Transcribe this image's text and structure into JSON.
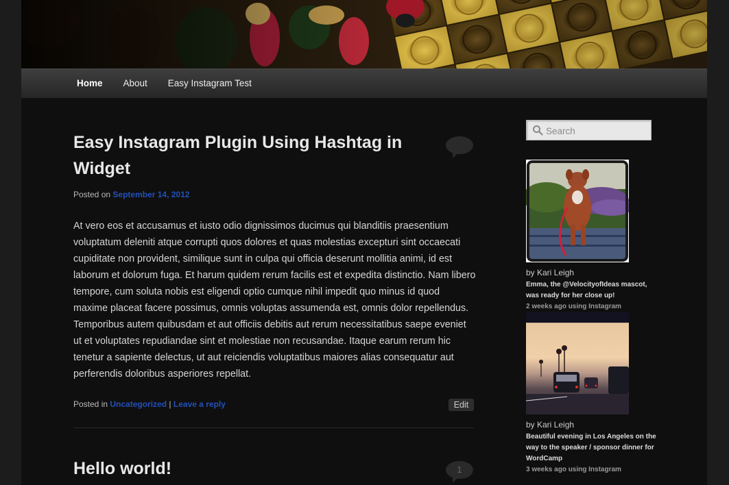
{
  "nav": {
    "items": [
      {
        "label": "Home"
      },
      {
        "label": "About"
      },
      {
        "label": "Easy Instagram Test"
      }
    ]
  },
  "posts": [
    {
      "title": "Easy Instagram Plugin Using Hashtag in Widget",
      "posted_on_label": "Posted on",
      "date": "September 14, 2012",
      "content": "At vero eos et accusamus et iusto odio dignissimos ducimus qui blanditiis praesentium voluptatum deleniti atque corrupti quos dolores et quas molestias excepturi sint occaecati cupiditate non provident, similique sunt in culpa qui officia deserunt mollitia animi, id est laborum et dolorum fuga. Et harum quidem rerum facilis est et expedita distinctio. Nam libero tempore, cum soluta nobis est eligendi optio cumque nihil impedit quo minus id quod maxime placeat facere possimus, omnis voluptas assumenda est, omnis dolor repellendus. Temporibus autem quibusdam et aut officiis debitis aut rerum necessitatibus saepe eveniet ut et voluptates repudiandae sint et molestiae non recusandae. Itaque earum rerum hic tenetur a sapiente delectus, ut aut reiciendis voluptatibus maiores alias consequatur aut perferendis doloribus asperiores repellat.",
      "posted_in_label": "Posted in",
      "category": "Uncategorized",
      "separator": "|",
      "reply_link": "Leave a reply",
      "edit_label": "Edit",
      "comment_count": ""
    },
    {
      "title": "Hello world!",
      "comment_count": "1"
    }
  ],
  "sidebar": {
    "search": {
      "placeholder": "Search"
    },
    "instagram": [
      {
        "author": "by Kari Leigh",
        "caption": "Emma, the @VelocityofIdeas mascot, was ready for her close up!",
        "time": "2 weeks ago using Instagram"
      },
      {
        "author": "by Kari Leigh",
        "caption": "Beautiful evening in Los Angeles on the way to the speaker / sponsor dinner for WordCamp",
        "time": "3 weeks ago using Instagram"
      }
    ]
  },
  "colors": {
    "link": "#2450b8",
    "background": "#0f0f0f",
    "nav_bar": "#333333"
  }
}
